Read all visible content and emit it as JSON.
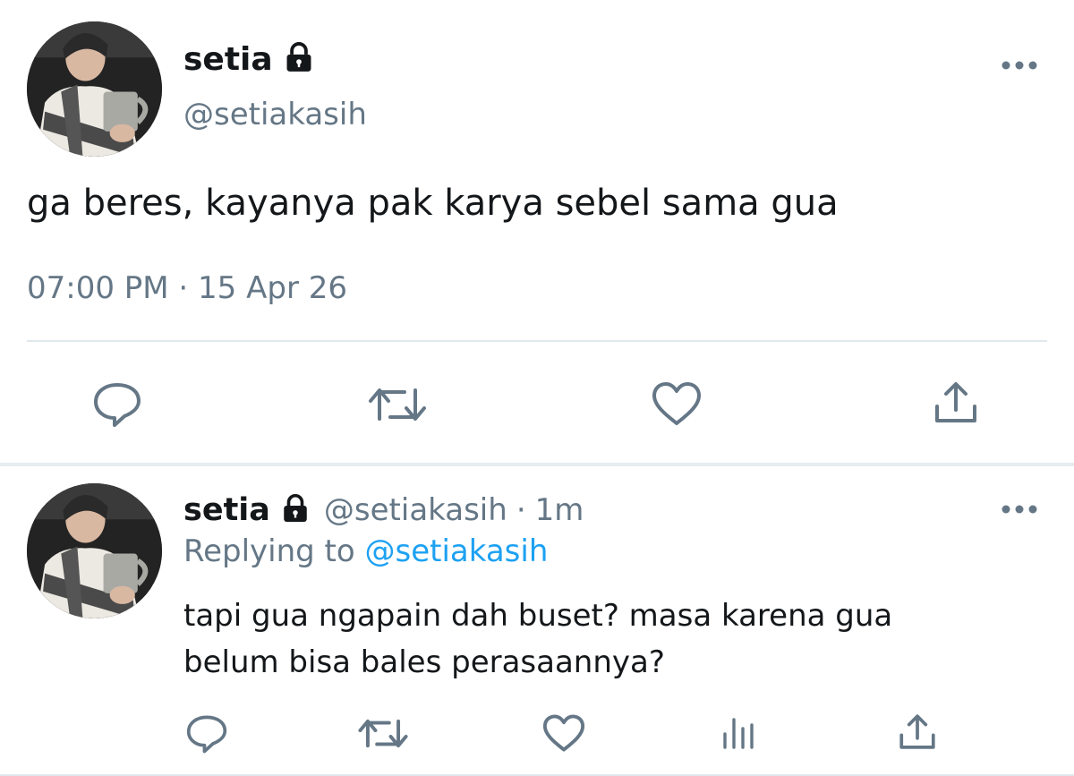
{
  "main_tweet": {
    "display_name": "setia",
    "handle": "@setiakasih",
    "text": "ga beres, kayanya pak karya sebel sama gua",
    "timestamp": "07:00 PM · 15 Apr 26",
    "icons": [
      "lock-icon",
      "more-icon",
      "reply-icon",
      "retweet-icon",
      "like-icon",
      "share-icon"
    ]
  },
  "reply_tweet": {
    "display_name": "setia",
    "handle": "@setiakasih",
    "separator": "·",
    "age": "1m",
    "replying_prefix": "Replying to",
    "replying_to": "@setiakasih",
    "text_lines": [
      "tapi gua ngapain dah buset? masa karena gua",
      "belum bisa bales perasaannya?"
    ],
    "icons": [
      "lock-icon",
      "more-icon",
      "reply-icon",
      "retweet-icon",
      "like-icon",
      "analytics-icon",
      "share-icon"
    ]
  },
  "colors": {
    "text_primary": "#14171a",
    "text_secondary": "#657786",
    "link": "#1da1f2",
    "divider": "#e1e8ed"
  }
}
